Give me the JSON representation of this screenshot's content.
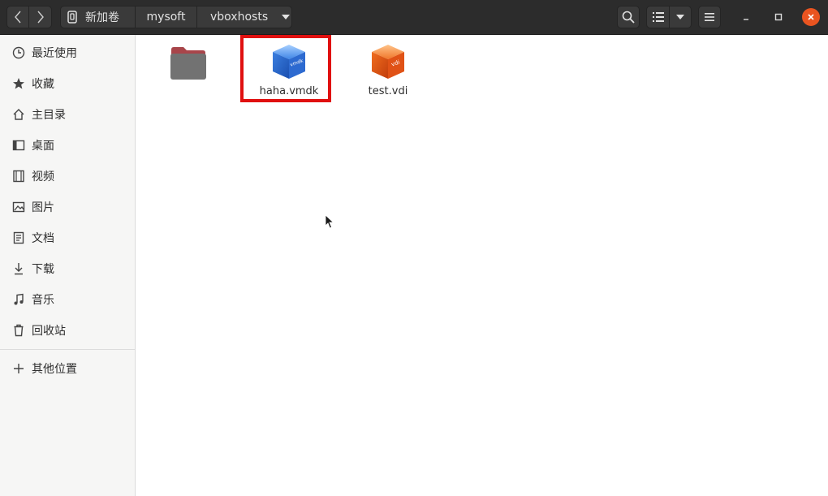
{
  "header": {
    "breadcrumb": [
      "新加卷",
      "mysoft",
      "vboxhosts"
    ],
    "icons": {
      "back": "chevron-left-icon",
      "forward": "chevron-right-icon",
      "drive": "drive-icon",
      "dropdown": "triangle-down-icon",
      "search": "search-icon",
      "list_view": "list-view-icon",
      "view_dropdown": "triangle-down-icon",
      "menu": "hamburger-menu-icon",
      "minimize": "minimize-icon",
      "maximize": "maximize-icon",
      "close": "close-icon"
    }
  },
  "sidebar": {
    "items": [
      {
        "label": "最近使用",
        "icon": "clock-icon"
      },
      {
        "label": "收藏",
        "icon": "star-icon"
      },
      {
        "label": "主目录",
        "icon": "home-icon"
      },
      {
        "label": "桌面",
        "icon": "desktop-icon"
      },
      {
        "label": "视频",
        "icon": "video-icon"
      },
      {
        "label": "图片",
        "icon": "image-icon"
      },
      {
        "label": "文档",
        "icon": "document-icon"
      },
      {
        "label": "下载",
        "icon": "download-icon"
      },
      {
        "label": "音乐",
        "icon": "music-icon"
      },
      {
        "label": "回收站",
        "icon": "trash-icon"
      }
    ],
    "other_locations": {
      "label": "其他位置",
      "icon": "plus-icon"
    }
  },
  "files": [
    {
      "name": "",
      "icon": "folder-icon"
    },
    {
      "name": "haha.vmdk",
      "icon": "vmdk-file-icon",
      "badge": "vmdk",
      "highlighted": true
    },
    {
      "name": "test.vdi",
      "icon": "vdi-file-icon",
      "badge": "vdi"
    }
  ],
  "colors": {
    "header_bg": "#2c2c2c",
    "accent_close": "#e95420",
    "highlight": "#e01010",
    "sidebar_bg": "#f6f6f5"
  }
}
